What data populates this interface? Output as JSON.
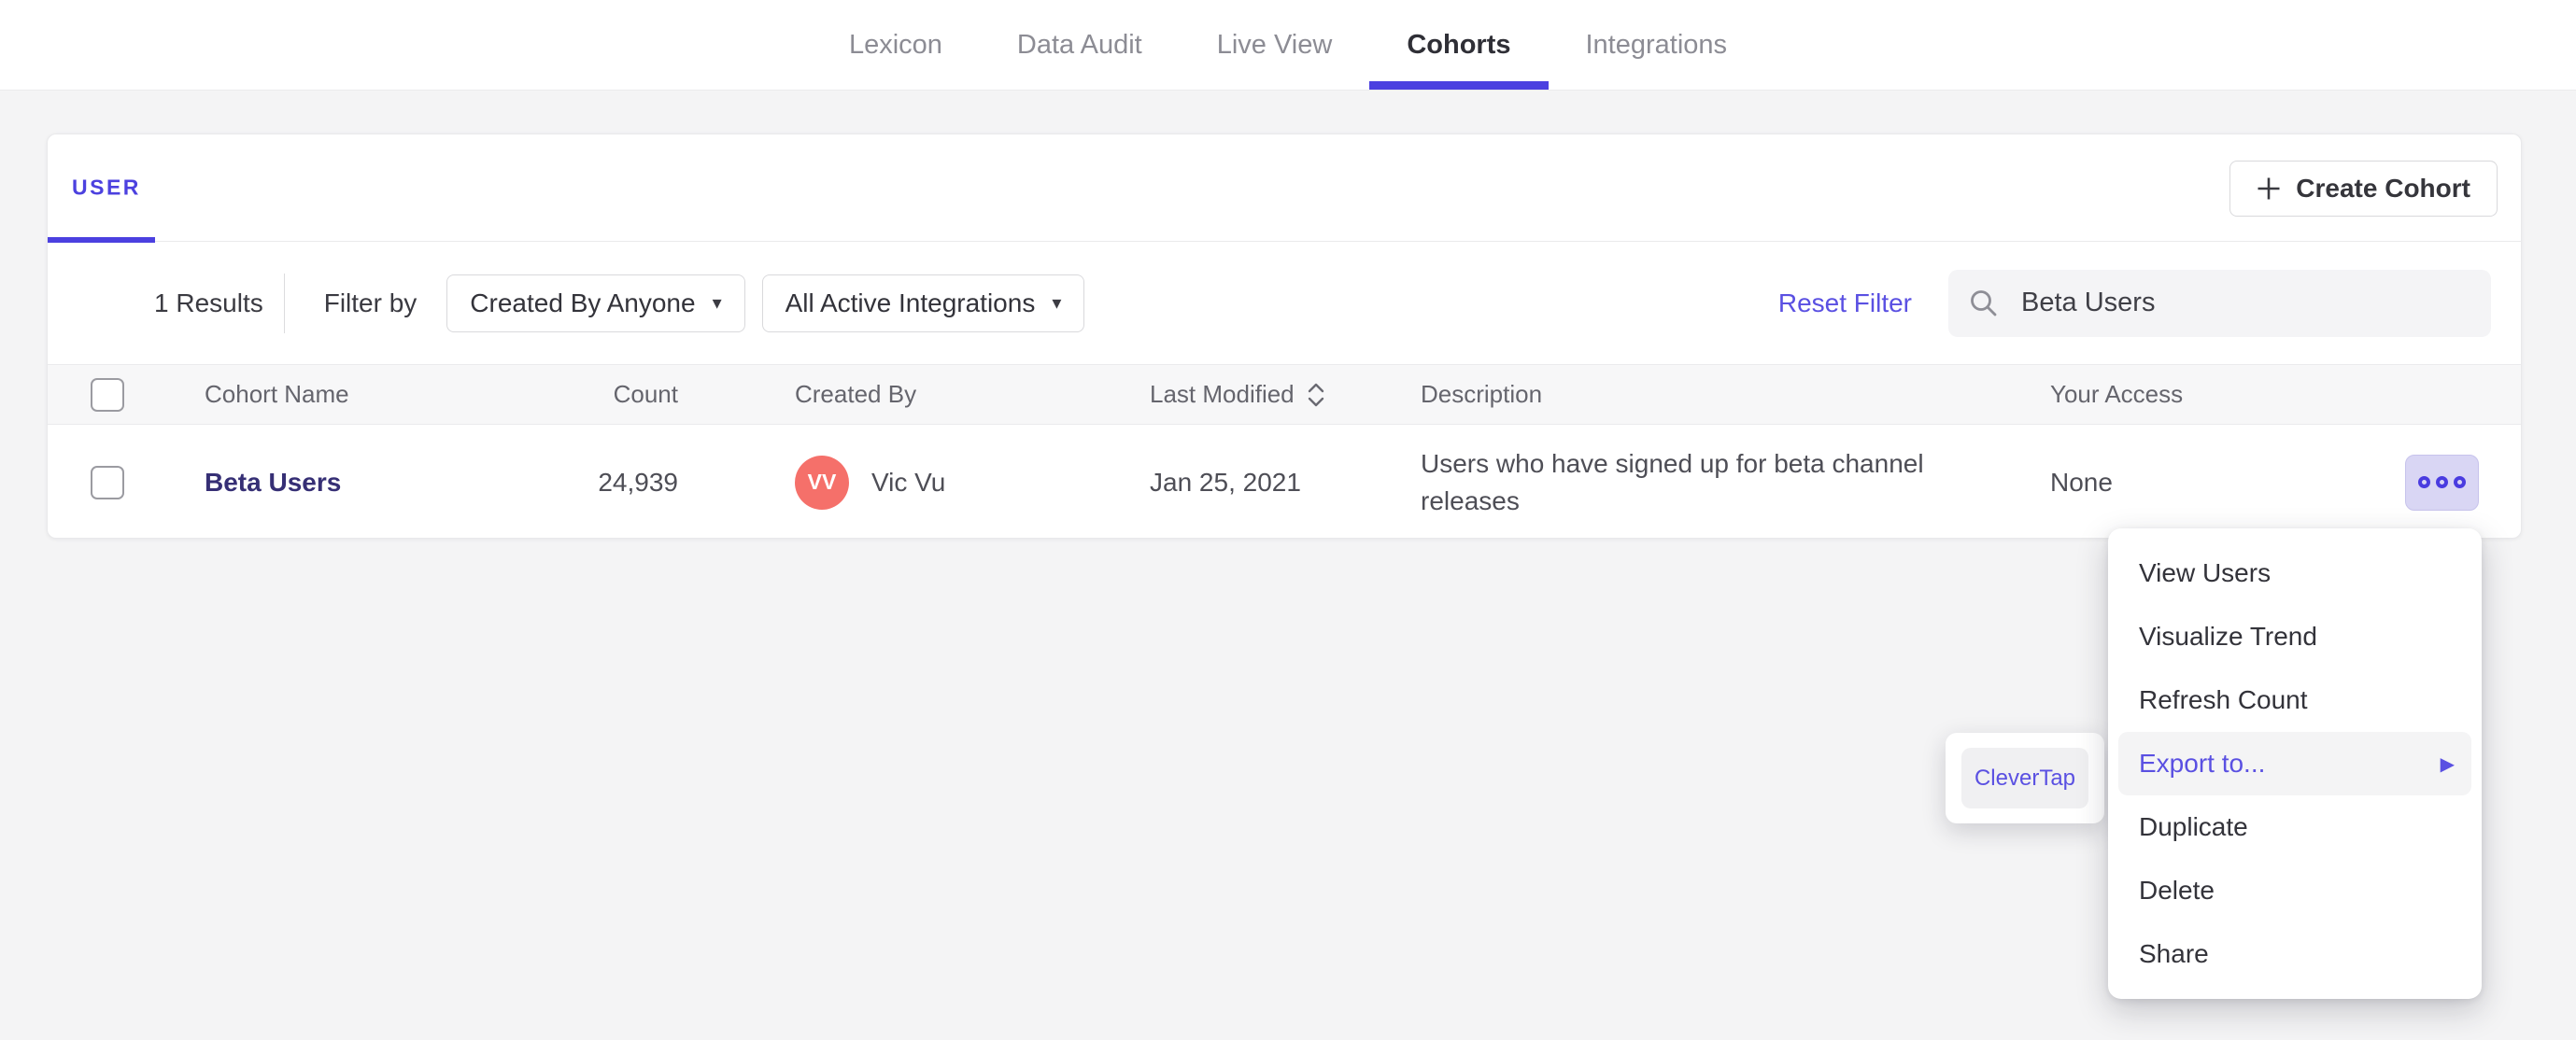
{
  "nav": {
    "tabs": [
      {
        "label": "Lexicon",
        "active": false
      },
      {
        "label": "Data Audit",
        "active": false
      },
      {
        "label": "Live View",
        "active": false
      },
      {
        "label": "Cohorts",
        "active": true
      },
      {
        "label": "Integrations",
        "active": false
      }
    ]
  },
  "card": {
    "user_tab": "USER",
    "create_button": "Create Cohort",
    "filter": {
      "results": "1 Results",
      "filter_by": "Filter by",
      "created_by_dropdown": "Created By Anyone",
      "integrations_dropdown": "All Active Integrations",
      "reset": "Reset Filter",
      "search_value": "Beta Users"
    },
    "table": {
      "headers": {
        "name": "Cohort Name",
        "count": "Count",
        "created_by": "Created By",
        "last_modified": "Last Modified",
        "description": "Description",
        "access": "Your Access"
      },
      "rows": [
        {
          "name": "Beta Users",
          "count": "24,939",
          "avatar_initials": "VV",
          "created_by": "Vic Vu",
          "last_modified": "Jan 25, 2021",
          "description": "Users who have signed up for beta channel releases",
          "access": "None"
        }
      ]
    }
  },
  "menu": {
    "items": [
      "View Users",
      "Visualize Trend",
      "Refresh Count",
      "Export to...",
      "Duplicate",
      "Delete",
      "Share"
    ],
    "highlighted_item": "Export to...",
    "submenu_items": [
      "CleverTap"
    ]
  },
  "icons": {
    "plus": "plus-cross",
    "caret_down": "▾",
    "submenu_arrow": "▶",
    "search": "magnifier",
    "sort": "up-down-chevrons",
    "more": "three-dots"
  },
  "colors": {
    "accent_purple": "#4b40e0",
    "link_purple": "#5a50e2",
    "cohort_link": "#362f75",
    "avatar_coral": "#f5706a",
    "more_button_bg": "#d9d6f4",
    "menu_highlight_bg": "#f4f4f5",
    "table_header_bg": "#f7f7f8",
    "page_bg": "#f4f4f5"
  }
}
